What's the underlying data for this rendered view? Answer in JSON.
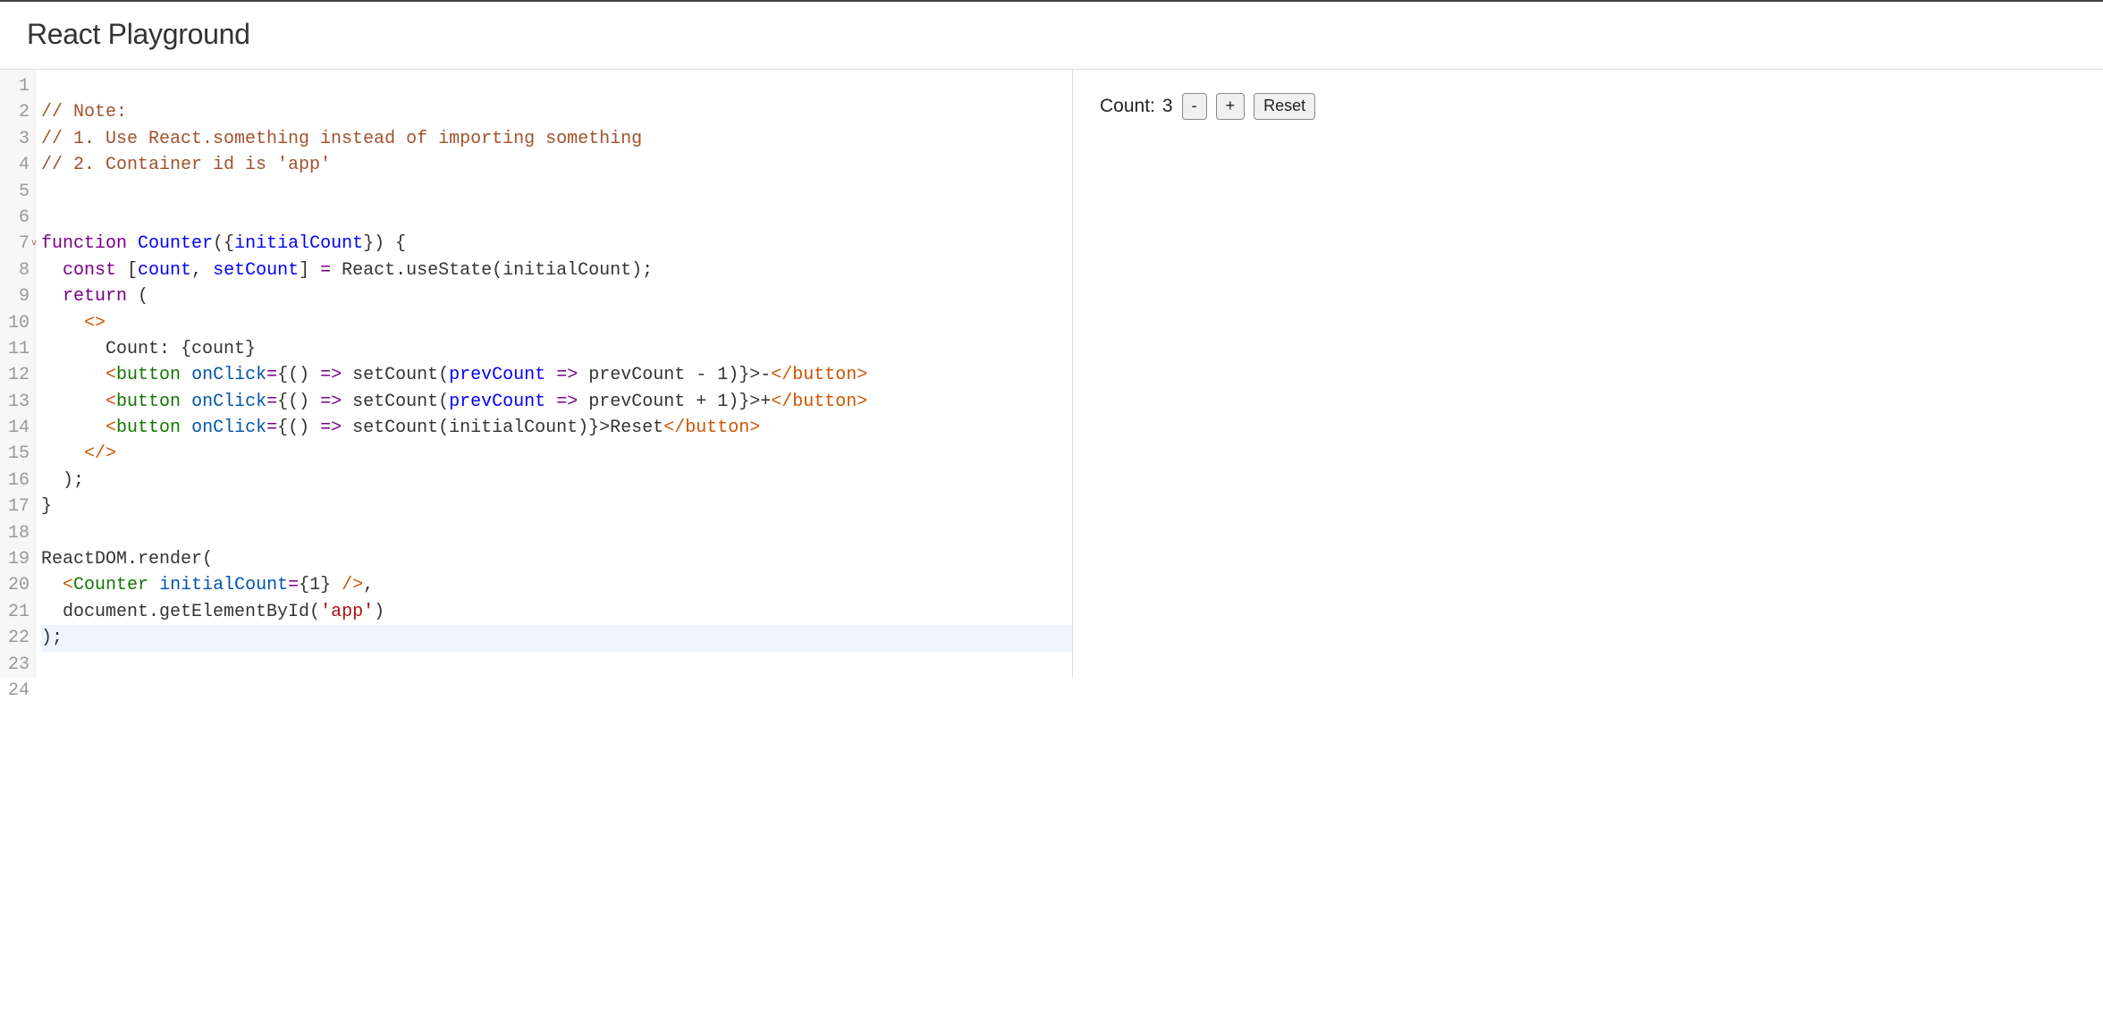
{
  "header": {
    "title": "React Playground"
  },
  "editor": {
    "line_count": 24,
    "fold_line": 7,
    "active_line": 22,
    "code": {
      "l1": "",
      "l2_c": "// Note:",
      "l3_c": "// 1. Use React.something instead of importing something",
      "l4_c": "// 2. Container id is 'app'",
      "l5": "",
      "l6": "",
      "l7_kw": "function",
      "l7_def": "Counter",
      "l7_b1": "({",
      "l7_arg": "initialCount",
      "l7_b2": "}) {",
      "l8_ind": "  ",
      "l8_kw": "const",
      "l8_sp": " [",
      "l8_v1": "count",
      "l8_cm": ", ",
      "l8_v2": "setCount",
      "l8_cl": "] ",
      "l8_op": "=",
      "l8_rest": " React.useState(initialCount);",
      "l9_ind": "  ",
      "l9_kw": "return",
      "l9_rest": " (",
      "l10_ind": "    ",
      "l10_frag": "<>",
      "l11_ind": "      ",
      "l11_txt": "Count: {count}",
      "l12_ind": "      ",
      "l12_open": "<",
      "l12_tag": "button",
      "l12_sp": " ",
      "l12_attr": "onClick",
      "l12_eq": "=",
      "l12_b1": "{() ",
      "l12_ar": "=>",
      "l12_fn": " setCount(",
      "l12_pv": "prevCount",
      "l12_ar2": " =>",
      "l12_expr": " prevCount - 1)}>-",
      "l12_cl1": "</",
      "l12_cltag": "button",
      "l12_cl2": ">",
      "l13_ind": "      ",
      "l13_open": "<",
      "l13_tag": "button",
      "l13_sp": " ",
      "l13_attr": "onClick",
      "l13_eq": "=",
      "l13_b1": "{() ",
      "l13_ar": "=>",
      "l13_fn": " setCount(",
      "l13_pv": "prevCount",
      "l13_ar2": " =>",
      "l13_expr": " prevCount + 1)}>+",
      "l13_cl1": "</",
      "l13_cltag": "button",
      "l13_cl2": ">",
      "l14_ind": "      ",
      "l14_open": "<",
      "l14_tag": "button",
      "l14_sp": " ",
      "l14_attr": "onClick",
      "l14_eq": "=",
      "l14_b1": "{() ",
      "l14_ar": "=>",
      "l14_expr": " setCount(initialCount)}>Reset",
      "l14_cl1": "</",
      "l14_cltag": "button",
      "l14_cl2": ">",
      "l15_ind": "    ",
      "l15_frag": "</>",
      "l16": "  );",
      "l17": "}",
      "l18": "",
      "l19": "ReactDOM.render(",
      "l20_ind": "  ",
      "l20_open": "<",
      "l20_tag": "Counter",
      "l20_sp": " ",
      "l20_attr": "initialCount",
      "l20_eq": "=",
      "l20_val": "{1}",
      "l20_close": " />",
      "l20_comma": ",",
      "l21_ind": "  ",
      "l21_a": "document.getElementById(",
      "l21_str": "'app'",
      "l21_b": ")",
      "l22": ");",
      "l23": "",
      "l24": ""
    }
  },
  "preview": {
    "label": "Count:",
    "value": "3",
    "btn_minus": "-",
    "btn_plus": "+",
    "btn_reset": "Reset"
  }
}
